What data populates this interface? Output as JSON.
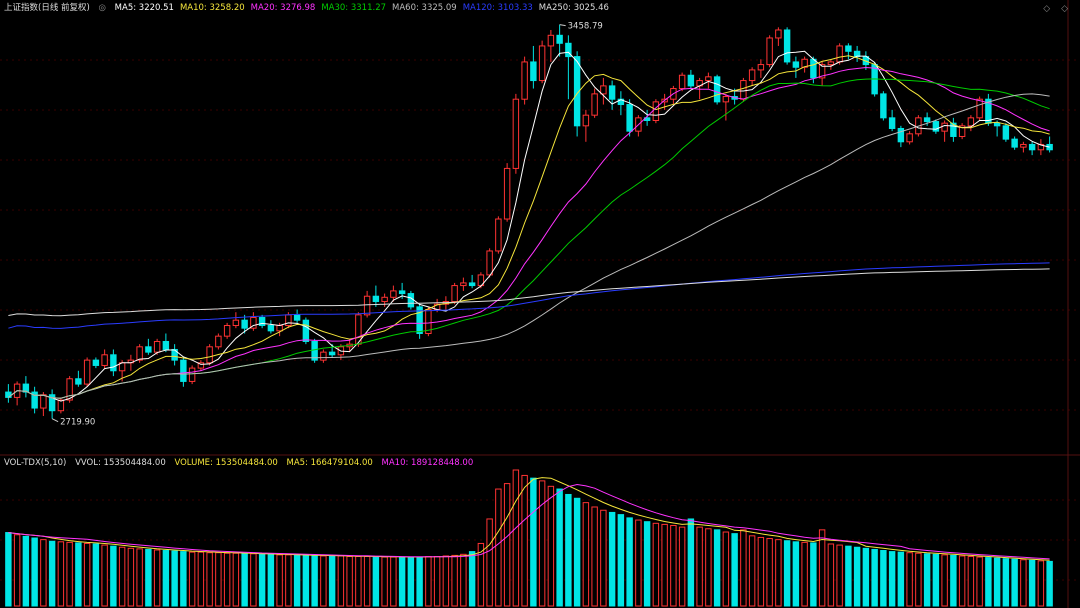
{
  "header": {
    "title": "上证指数(日线 前复权)",
    "ma": [
      {
        "label": "MA5: 3220.51",
        "color": "#ffffff"
      },
      {
        "label": "MA10: 3258.20",
        "color": "#f5e53b"
      },
      {
        "label": "MA20: 3276.98",
        "color": "#ff33ff"
      },
      {
        "label": "MA30: 3311.27",
        "color": "#00cc00"
      },
      {
        "label": "MA60: 3325.09",
        "color": "#bbbbbb"
      },
      {
        "label": "MA120: 3103.33",
        "color": "#2a3cff"
      },
      {
        "label": "MA250: 3025.46",
        "color": "#dddddd"
      }
    ],
    "corner_icons": "◇ ◇"
  },
  "volume_header": {
    "title": "VOL-TDX(5,10)",
    "vvol": "VVOL: 153504484.00",
    "volume": {
      "label": "VOLUME: 153504484.00",
      "color": "#f5e53b"
    },
    "ma5": {
      "label": "MA5: 166479104.00",
      "color": "#f5e53b"
    },
    "ma10": {
      "label": "MA10: 189128448.00",
      "color": "#ff33ff"
    }
  },
  "colors": {
    "up": "#ff3333",
    "down": "#00e5e5",
    "background": "#000000",
    "grid": "#3a0000"
  },
  "chart_data": {
    "type": "candlestick",
    "price_range": [
      2680,
      3480
    ],
    "annotations": [
      {
        "label": "3458.79",
        "kind": "high",
        "index": 63
      },
      {
        "label": "2719.90",
        "kind": "low",
        "index": 5
      }
    ],
    "ohlc": [
      [
        2770,
        2785,
        2750,
        2760
      ],
      [
        2760,
        2790,
        2745,
        2785
      ],
      [
        2785,
        2800,
        2760,
        2770
      ],
      [
        2770,
        2780,
        2730,
        2740
      ],
      [
        2740,
        2770,
        2725,
        2765
      ],
      [
        2765,
        2775,
        2720,
        2735
      ],
      [
        2735,
        2760,
        2730,
        2755
      ],
      [
        2755,
        2800,
        2750,
        2795
      ],
      [
        2795,
        2810,
        2780,
        2785
      ],
      [
        2785,
        2835,
        2780,
        2830
      ],
      [
        2830,
        2835,
        2815,
        2820
      ],
      [
        2820,
        2850,
        2815,
        2840
      ],
      [
        2840,
        2850,
        2800,
        2810
      ],
      [
        2810,
        2830,
        2790,
        2825
      ],
      [
        2825,
        2840,
        2810,
        2830
      ],
      [
        2830,
        2860,
        2825,
        2855
      ],
      [
        2855,
        2870,
        2840,
        2845
      ],
      [
        2845,
        2870,
        2840,
        2865
      ],
      [
        2865,
        2880,
        2845,
        2850
      ],
      [
        2850,
        2860,
        2820,
        2830
      ],
      [
        2830,
        2835,
        2780,
        2790
      ],
      [
        2790,
        2820,
        2785,
        2815
      ],
      [
        2815,
        2830,
        2810,
        2825
      ],
      [
        2825,
        2860,
        2820,
        2855
      ],
      [
        2855,
        2880,
        2850,
        2875
      ],
      [
        2875,
        2900,
        2870,
        2895
      ],
      [
        2895,
        2920,
        2890,
        2905
      ],
      [
        2905,
        2915,
        2880,
        2890
      ],
      [
        2890,
        2920,
        2885,
        2910
      ],
      [
        2910,
        2915,
        2890,
        2895
      ],
      [
        2895,
        2905,
        2880,
        2885
      ],
      [
        2885,
        2900,
        2875,
        2895
      ],
      [
        2895,
        2920,
        2890,
        2915
      ],
      [
        2915,
        2925,
        2900,
        2905
      ],
      [
        2905,
        2910,
        2860,
        2865
      ],
      [
        2865,
        2870,
        2825,
        2830
      ],
      [
        2830,
        2850,
        2825,
        2845
      ],
      [
        2845,
        2860,
        2835,
        2840
      ],
      [
        2840,
        2860,
        2830,
        2855
      ],
      [
        2855,
        2870,
        2845,
        2860
      ],
      [
        2860,
        2920,
        2855,
        2915
      ],
      [
        2915,
        2960,
        2910,
        2950
      ],
      [
        2950,
        2970,
        2930,
        2940
      ],
      [
        2940,
        2955,
        2930,
        2948
      ],
      [
        2948,
        2970,
        2940,
        2960
      ],
      [
        2960,
        2975,
        2945,
        2955
      ],
      [
        2955,
        2960,
        2925,
        2930
      ],
      [
        2930,
        2935,
        2870,
        2880
      ],
      [
        2880,
        2930,
        2875,
        2925
      ],
      [
        2925,
        2945,
        2920,
        2935
      ],
      [
        2935,
        2950,
        2925,
        2940
      ],
      [
        2940,
        2975,
        2935,
        2970
      ],
      [
        2970,
        2985,
        2960,
        2975
      ],
      [
        2975,
        2990,
        2965,
        2970
      ],
      [
        2970,
        2995,
        2965,
        2990
      ],
      [
        2990,
        3040,
        2985,
        3035
      ],
      [
        3035,
        3100,
        3030,
        3095
      ],
      [
        3095,
        3200,
        3090,
        3190
      ],
      [
        3190,
        3330,
        3180,
        3320
      ],
      [
        3320,
        3400,
        3310,
        3390
      ],
      [
        3390,
        3420,
        3340,
        3355
      ],
      [
        3355,
        3430,
        3350,
        3420
      ],
      [
        3420,
        3450,
        3390,
        3440
      ],
      [
        3440,
        3460,
        3400,
        3425
      ],
      [
        3425,
        3440,
        3320,
        3400
      ],
      [
        3400,
        3410,
        3250,
        3270
      ],
      [
        3270,
        3300,
        3240,
        3290
      ],
      [
        3290,
        3340,
        3285,
        3330
      ],
      [
        3330,
        3360,
        3310,
        3345
      ],
      [
        3345,
        3355,
        3300,
        3320
      ],
      [
        3320,
        3335,
        3290,
        3310
      ],
      [
        3310,
        3320,
        3250,
        3260
      ],
      [
        3260,
        3290,
        3250,
        3285
      ],
      [
        3285,
        3300,
        3270,
        3280
      ],
      [
        3280,
        3320,
        3275,
        3315
      ],
      [
        3315,
        3330,
        3300,
        3320
      ],
      [
        3320,
        3345,
        3310,
        3340
      ],
      [
        3340,
        3370,
        3335,
        3365
      ],
      [
        3365,
        3375,
        3340,
        3345
      ],
      [
        3345,
        3360,
        3320,
        3355
      ],
      [
        3355,
        3370,
        3340,
        3362
      ],
      [
        3362,
        3366,
        3310,
        3315
      ],
      [
        3315,
        3330,
        3280,
        3325
      ],
      [
        3325,
        3340,
        3310,
        3320
      ],
      [
        3320,
        3360,
        3315,
        3355
      ],
      [
        3355,
        3380,
        3345,
        3375
      ],
      [
        3375,
        3395,
        3360,
        3385
      ],
      [
        3385,
        3440,
        3380,
        3435
      ],
      [
        3435,
        3455,
        3420,
        3450
      ],
      [
        3450,
        3455,
        3385,
        3390
      ],
      [
        3390,
        3400,
        3360,
        3380
      ],
      [
        3380,
        3400,
        3370,
        3395
      ],
      [
        3395,
        3400,
        3350,
        3360
      ],
      [
        3360,
        3390,
        3345,
        3385
      ],
      [
        3385,
        3395,
        3375,
        3390
      ],
      [
        3390,
        3425,
        3385,
        3420
      ],
      [
        3420,
        3425,
        3395,
        3410
      ],
      [
        3410,
        3420,
        3390,
        3400
      ],
      [
        3400,
        3410,
        3375,
        3385
      ],
      [
        3385,
        3390,
        3325,
        3330
      ],
      [
        3330,
        3335,
        3280,
        3285
      ],
      [
        3285,
        3300,
        3260,
        3265
      ],
      [
        3265,
        3270,
        3230,
        3240
      ],
      [
        3240,
        3260,
        3235,
        3255
      ],
      [
        3255,
        3290,
        3250,
        3285
      ],
      [
        3285,
        3295,
        3270,
        3278
      ],
      [
        3278,
        3282,
        3255,
        3260
      ],
      [
        3260,
        3280,
        3240,
        3275
      ],
      [
        3275,
        3285,
        3240,
        3250
      ],
      [
        3250,
        3275,
        3245,
        3270
      ],
      [
        3270,
        3290,
        3260,
        3285
      ],
      [
        3285,
        3325,
        3280,
        3320
      ],
      [
        3320,
        3330,
        3270,
        3275
      ],
      [
        3275,
        3280,
        3250,
        3270
      ],
      [
        3270,
        3275,
        3240,
        3245
      ],
      [
        3245,
        3250,
        3225,
        3230
      ],
      [
        3230,
        3240,
        3220,
        3235
      ],
      [
        3235,
        3240,
        3215,
        3225
      ],
      [
        3225,
        3245,
        3215,
        3235
      ],
      [
        3235,
        3250,
        3220,
        3225
      ]
    ],
    "volume": [
      135,
      131,
      128,
      125,
      122,
      119,
      118,
      117,
      116,
      115,
      114,
      112,
      110,
      108,
      106,
      105,
      104,
      103,
      102,
      101,
      100,
      99,
      99,
      98,
      98,
      97,
      97,
      96,
      96,
      95,
      95,
      94,
      94,
      93,
      93,
      93,
      92,
      92,
      92,
      91,
      91,
      91,
      90,
      90,
      90,
      90,
      90,
      90,
      91,
      91,
      92,
      93,
      95,
      100,
      115,
      160,
      215,
      225,
      250,
      240,
      235,
      230,
      220,
      215,
      205,
      198,
      190,
      182,
      176,
      172,
      168,
      162,
      158,
      155,
      152,
      150,
      148,
      145,
      160,
      145,
      142,
      140,
      136,
      133,
      140,
      129,
      126,
      124,
      122,
      120,
      118,
      117,
      116,
      140,
      114,
      112,
      110,
      108,
      106,
      104,
      102,
      100,
      99,
      98,
      97,
      96,
      95,
      94,
      93,
      92,
      91,
      90,
      89,
      88,
      87,
      86,
      85,
      84,
      83,
      82
    ],
    "volume_range": [
      0,
      250
    ]
  }
}
